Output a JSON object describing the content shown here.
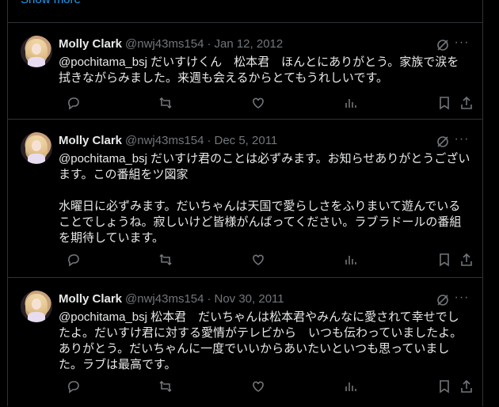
{
  "show_more": "Show more",
  "tweets": [
    {
      "name": "Molly Clark",
      "handle": "@nwj43ms154",
      "sep": "·",
      "date": "Jan 12, 2012",
      "text": "@pochitama_bsj だいすけくん　松本君　ほんとにありがとう。家族で涙を拭きながらみました。来週も会えるからとてもうれしいです。"
    },
    {
      "name": "Molly Clark",
      "handle": "@nwj43ms154",
      "sep": "·",
      "date": "Dec 5, 2011",
      "text": "@pochitama_bsj だいすけ君のことは必ずみます。お知らせありがとうございます。この番組をツ図家\n\n水曜日に必ずみます。だいちゃんは天国で愛らしさをふりまいて遊んでいることでしょうね。寂しいけど皆様がんばってください。ラブラドールの番組を期待しています。"
    },
    {
      "name": "Molly Clark",
      "handle": "@nwj43ms154",
      "sep": "·",
      "date": "Nov 30, 2011",
      "text": "@pochitama_bsj 松本君　だいちゃんは松本君やみんなに愛されて幸せでしたよ。だいすけ君に対する愛情がテレビから　いつも伝わっていましたよ。ありがとう。だいちゃんに一度でいいからあいたいといつも思っていました。ラブは最高です。"
    }
  ],
  "icons": {
    "grok": "grok-icon",
    "more": "more-icon",
    "reply": "reply-icon",
    "retweet": "retweet-icon",
    "like": "heart-icon",
    "views": "views-icon",
    "bookmark": "bookmark-icon",
    "share": "share-icon"
  },
  "colors": {
    "background": "#000000",
    "text": "#e7e9ea",
    "secondary": "#71767b",
    "border": "#2f3336",
    "link": "#1d9bf0"
  }
}
